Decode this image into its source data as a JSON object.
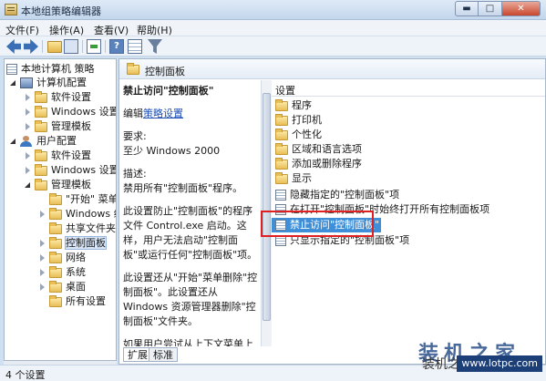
{
  "window": {
    "title": "本地组策略编辑器",
    "min": "▬",
    "max": "□",
    "close": "✕"
  },
  "menu": [
    "文件(F)",
    "操作(A)",
    "查看(V)",
    "帮助(H)"
  ],
  "tree": {
    "root": "本地计算机 策略",
    "computer": "计算机配置",
    "computer_children": [
      "软件设置",
      "Windows 设置",
      "管理模板"
    ],
    "user": "用户配置",
    "user_children": [
      "软件设置",
      "Windows 设置",
      "管理模板"
    ],
    "admin_children": [
      "\"开始\" 菜单",
      "Windows 组",
      "共享文件夹",
      "控制面板",
      "网络",
      "系统",
      "桌面",
      "所有设置"
    ]
  },
  "header": {
    "title": "控制面板"
  },
  "description": {
    "title": "禁止访问\"控制面板\"",
    "edit_prefix": "编辑",
    "edit_link": "策略设置",
    "req_label": "要求:",
    "req_value": "至少 Windows 2000",
    "desc_label": "描述:",
    "desc_value": "禁用所有\"控制面板\"程序。",
    "para1": "此设置防止\"控制面板\"的程序文件 Control.exe 启动。这样，用户无法启动\"控制面板\"或运行任何\"控制面板\"项。",
    "para2": "此设置还从\"开始\"菜单删除\"控制面板\"。此设置还从 Windows 资源管理器删除\"控制面板\"文件夹。",
    "para3": "如果用户尝试从上下文菜单上的"
  },
  "tabs": [
    "扩展",
    "标准"
  ],
  "list": {
    "header": "设置",
    "items": [
      {
        "label": "程序",
        "type": "folder"
      },
      {
        "label": "打印机",
        "type": "folder"
      },
      {
        "label": "个性化",
        "type": "folder"
      },
      {
        "label": "区域和语言选项",
        "type": "folder"
      },
      {
        "label": "添加或删除程序",
        "type": "folder"
      },
      {
        "label": "显示",
        "type": "folder"
      },
      {
        "label": "隐藏指定的\"控制面板\"项",
        "type": "policy"
      },
      {
        "label": "在打开\"控制面板\"时始终打开所有控制面板项",
        "type": "policy"
      },
      {
        "label": "禁止访问\"控制面板\"",
        "type": "policy"
      },
      {
        "label": "只显示指定的\"控制面板\"项",
        "type": "policy"
      }
    ]
  },
  "status": {
    "text": "4 个设置"
  },
  "watermark": {
    "brand": "装机之家",
    "small": "装机之家",
    "url": "www.lotpc.com"
  },
  "colors": {
    "selection": "#3f8fd8",
    "highlight_box": "#e02020"
  }
}
